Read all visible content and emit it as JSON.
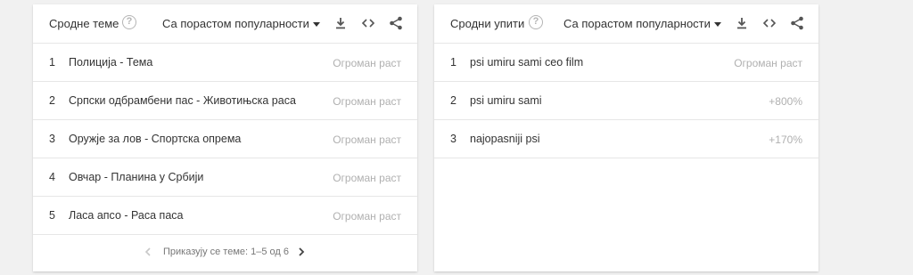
{
  "related_topics": {
    "title": "Сродне теме",
    "help": "?",
    "sort_label": "Са порастом популарности",
    "rows": [
      {
        "rank": "1",
        "label": "Полиција - Тема",
        "value": "Огроман раст"
      },
      {
        "rank": "2",
        "label": "Српски одбрамбени пас - Животињска раса",
        "value": "Огроман раст"
      },
      {
        "rank": "3",
        "label": "Оружје за лов - Спортска опрема",
        "value": "Огроман раст"
      },
      {
        "rank": "4",
        "label": "Овчар - Планина у Србији",
        "value": "Огроман раст"
      },
      {
        "rank": "5",
        "label": "Ласа апсо - Раса паса",
        "value": "Огроман раст"
      }
    ],
    "pagination": "Приказују се теме: 1–5 од 6"
  },
  "related_queries": {
    "title": "Сродни упити",
    "help": "?",
    "sort_label": "Са порастом популарности",
    "rows": [
      {
        "rank": "1",
        "label": "psi umiru sami ceo film",
        "value": "Огроман раст"
      },
      {
        "rank": "2",
        "label": "psi umiru sami",
        "value": "+800%"
      },
      {
        "rank": "3",
        "label": "najopasniji psi",
        "value": "+170%"
      }
    ]
  },
  "icons": {
    "help": "help-circle-icon",
    "download": "download-icon",
    "embed": "code-embed-icon",
    "share": "share-icon",
    "prev": "chevron-left-icon",
    "next": "chevron-right-icon"
  },
  "colors": {
    "text": "#333333",
    "muted": "#b0b0b0",
    "divider": "#e6e6e6",
    "background": "#f1f1f1"
  }
}
